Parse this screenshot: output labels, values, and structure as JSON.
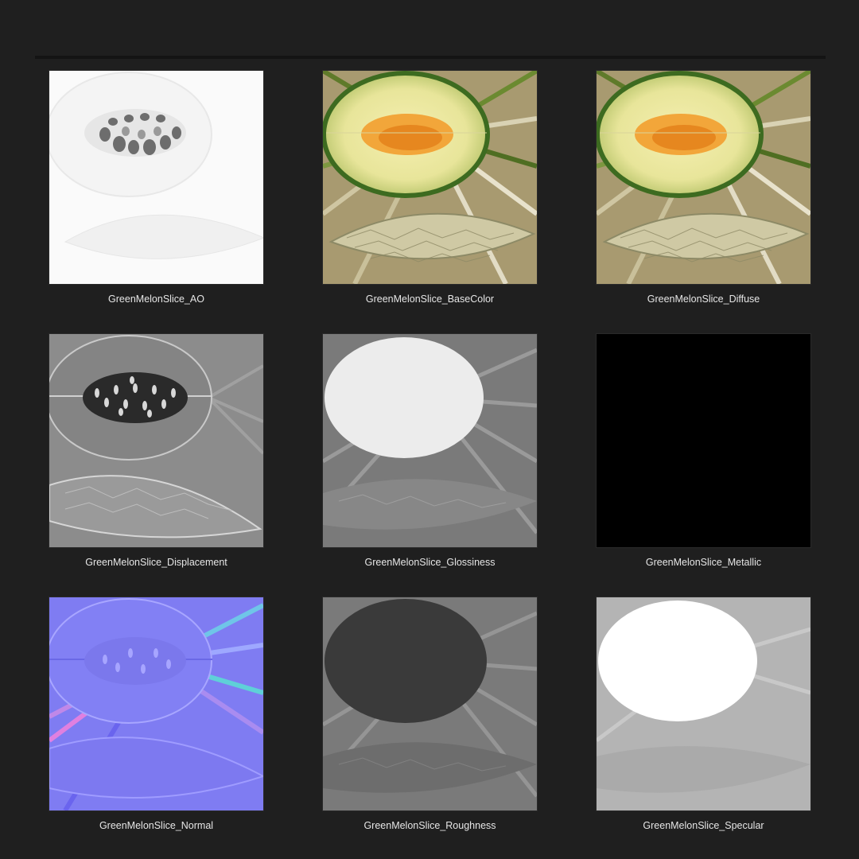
{
  "textures": [
    {
      "label": "GreenMelonSlice_AO",
      "icon": "ao-map-thumbnail"
    },
    {
      "label": "GreenMelonSlice_BaseColor",
      "icon": "basecolor-map-thumbnail"
    },
    {
      "label": "GreenMelonSlice_Diffuse",
      "icon": "diffuse-map-thumbnail"
    },
    {
      "label": "GreenMelonSlice_Displacement",
      "icon": "displacement-map-thumbnail"
    },
    {
      "label": "GreenMelonSlice_Glossiness",
      "icon": "glossiness-map-thumbnail"
    },
    {
      "label": "GreenMelonSlice_Metallic",
      "icon": "metallic-map-thumbnail"
    },
    {
      "label": "GreenMelonSlice_Normal",
      "icon": "normal-map-thumbnail"
    },
    {
      "label": "GreenMelonSlice_Roughness",
      "icon": "roughness-map-thumbnail"
    },
    {
      "label": "GreenMelonSlice_Specular",
      "icon": "specular-map-thumbnail"
    }
  ],
  "colors": {
    "background": "#1f1f1f",
    "caption": "#e6e6e6"
  }
}
